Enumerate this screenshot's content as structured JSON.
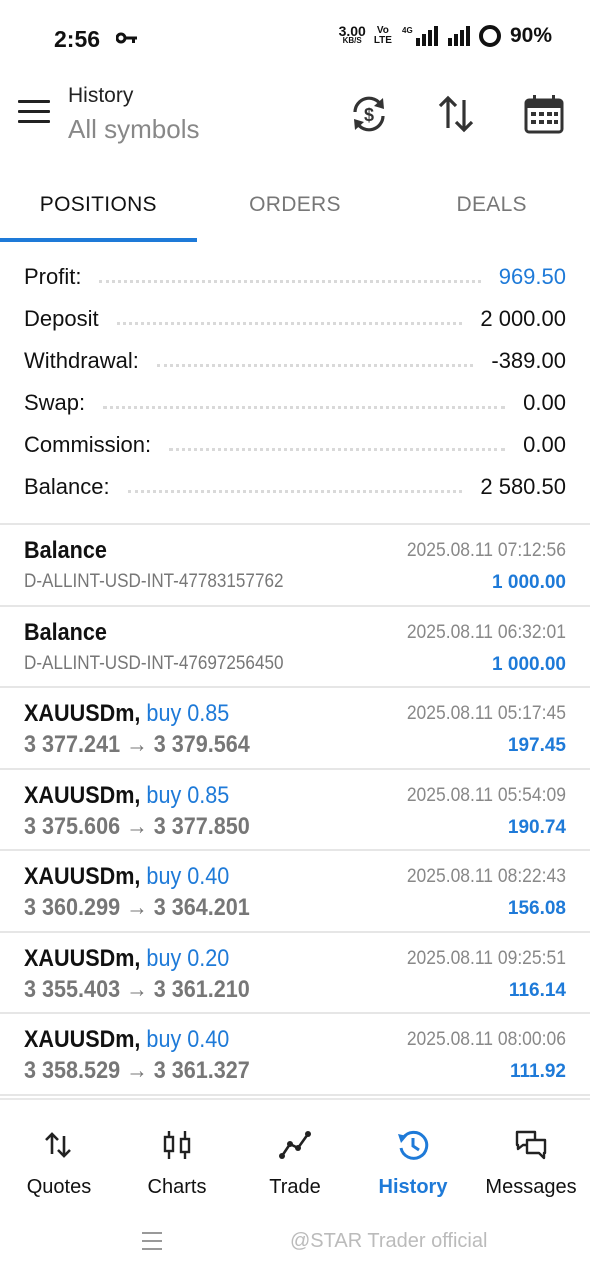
{
  "status_bar": {
    "time": "2:56",
    "speed_value": "3.00",
    "speed_unit": "KB/S",
    "volte_top": "Vo",
    "volte_bottom": "LTE",
    "network_label": "4G",
    "battery": "90%"
  },
  "header": {
    "title": "History",
    "subtitle": "All symbols",
    "icons": [
      "currency-exchange-icon",
      "sort-icon",
      "calendar-icon"
    ]
  },
  "tabs": [
    {
      "label": "POSITIONS",
      "active": true
    },
    {
      "label": "ORDERS",
      "active": false
    },
    {
      "label": "DEALS",
      "active": false
    }
  ],
  "summary": [
    {
      "label": "Profit:",
      "value": "969.50",
      "highlight": true
    },
    {
      "label": "Deposit",
      "value": "2 000.00"
    },
    {
      "label": "Withdrawal:",
      "value": "-389.00"
    },
    {
      "label": "Swap:",
      "value": "0.00"
    },
    {
      "label": "Commission:",
      "value": "0.00"
    },
    {
      "label": "Balance:",
      "value": "2 580.50"
    }
  ],
  "deals": [
    {
      "title": "Balance",
      "direction": "",
      "subtitle": "D-ALLINT-USD-INT-47783157762",
      "time": "2025.08.11 07:12:56",
      "amount": "1 000.00"
    },
    {
      "title": "Balance",
      "direction": "",
      "subtitle": "D-ALLINT-USD-INT-47697256450",
      "time": "2025.08.11 06:32:01",
      "amount": "1 000.00"
    },
    {
      "title": "XAUUSDm,",
      "direction": "buy 0.85",
      "subtitle": "3 377.241 → 3 379.564",
      "time": "2025.08.11 05:17:45",
      "amount": "197.45"
    },
    {
      "title": "XAUUSDm,",
      "direction": "buy 0.85",
      "subtitle": "3 375.606 → 3 377.850",
      "time": "2025.08.11 05:54:09",
      "amount": "190.74"
    },
    {
      "title": "XAUUSDm,",
      "direction": "buy 0.40",
      "subtitle": "3 360.299 → 3 364.201",
      "time": "2025.08.11 08:22:43",
      "amount": "156.08"
    },
    {
      "title": "XAUUSDm,",
      "direction": "buy 0.20",
      "subtitle": "3 355.403 → 3 361.210",
      "time": "2025.08.11 09:25:51",
      "amount": "116.14"
    },
    {
      "title": "XAUUSDm,",
      "direction": "buy 0.40",
      "subtitle": "3 358.529 → 3 361.327",
      "time": "2025.08.11 08:00:06",
      "amount": "111.92"
    }
  ],
  "bottom_nav": [
    {
      "label": "Quotes",
      "icon": "quotes-arrows-icon",
      "active": false
    },
    {
      "label": "Charts",
      "icon": "candlestick-icon",
      "active": false
    },
    {
      "label": "Trade",
      "icon": "trend-line-icon",
      "active": false
    },
    {
      "label": "History",
      "icon": "history-clock-icon",
      "active": true
    },
    {
      "label": "Messages",
      "icon": "chat-bubbles-icon",
      "active": false
    }
  ],
  "watermark": "@STAR Trader official",
  "colors": {
    "accent": "#1e7ad8",
    "text": "#111111",
    "muted": "#777777",
    "divider": "#e6e6e6"
  }
}
